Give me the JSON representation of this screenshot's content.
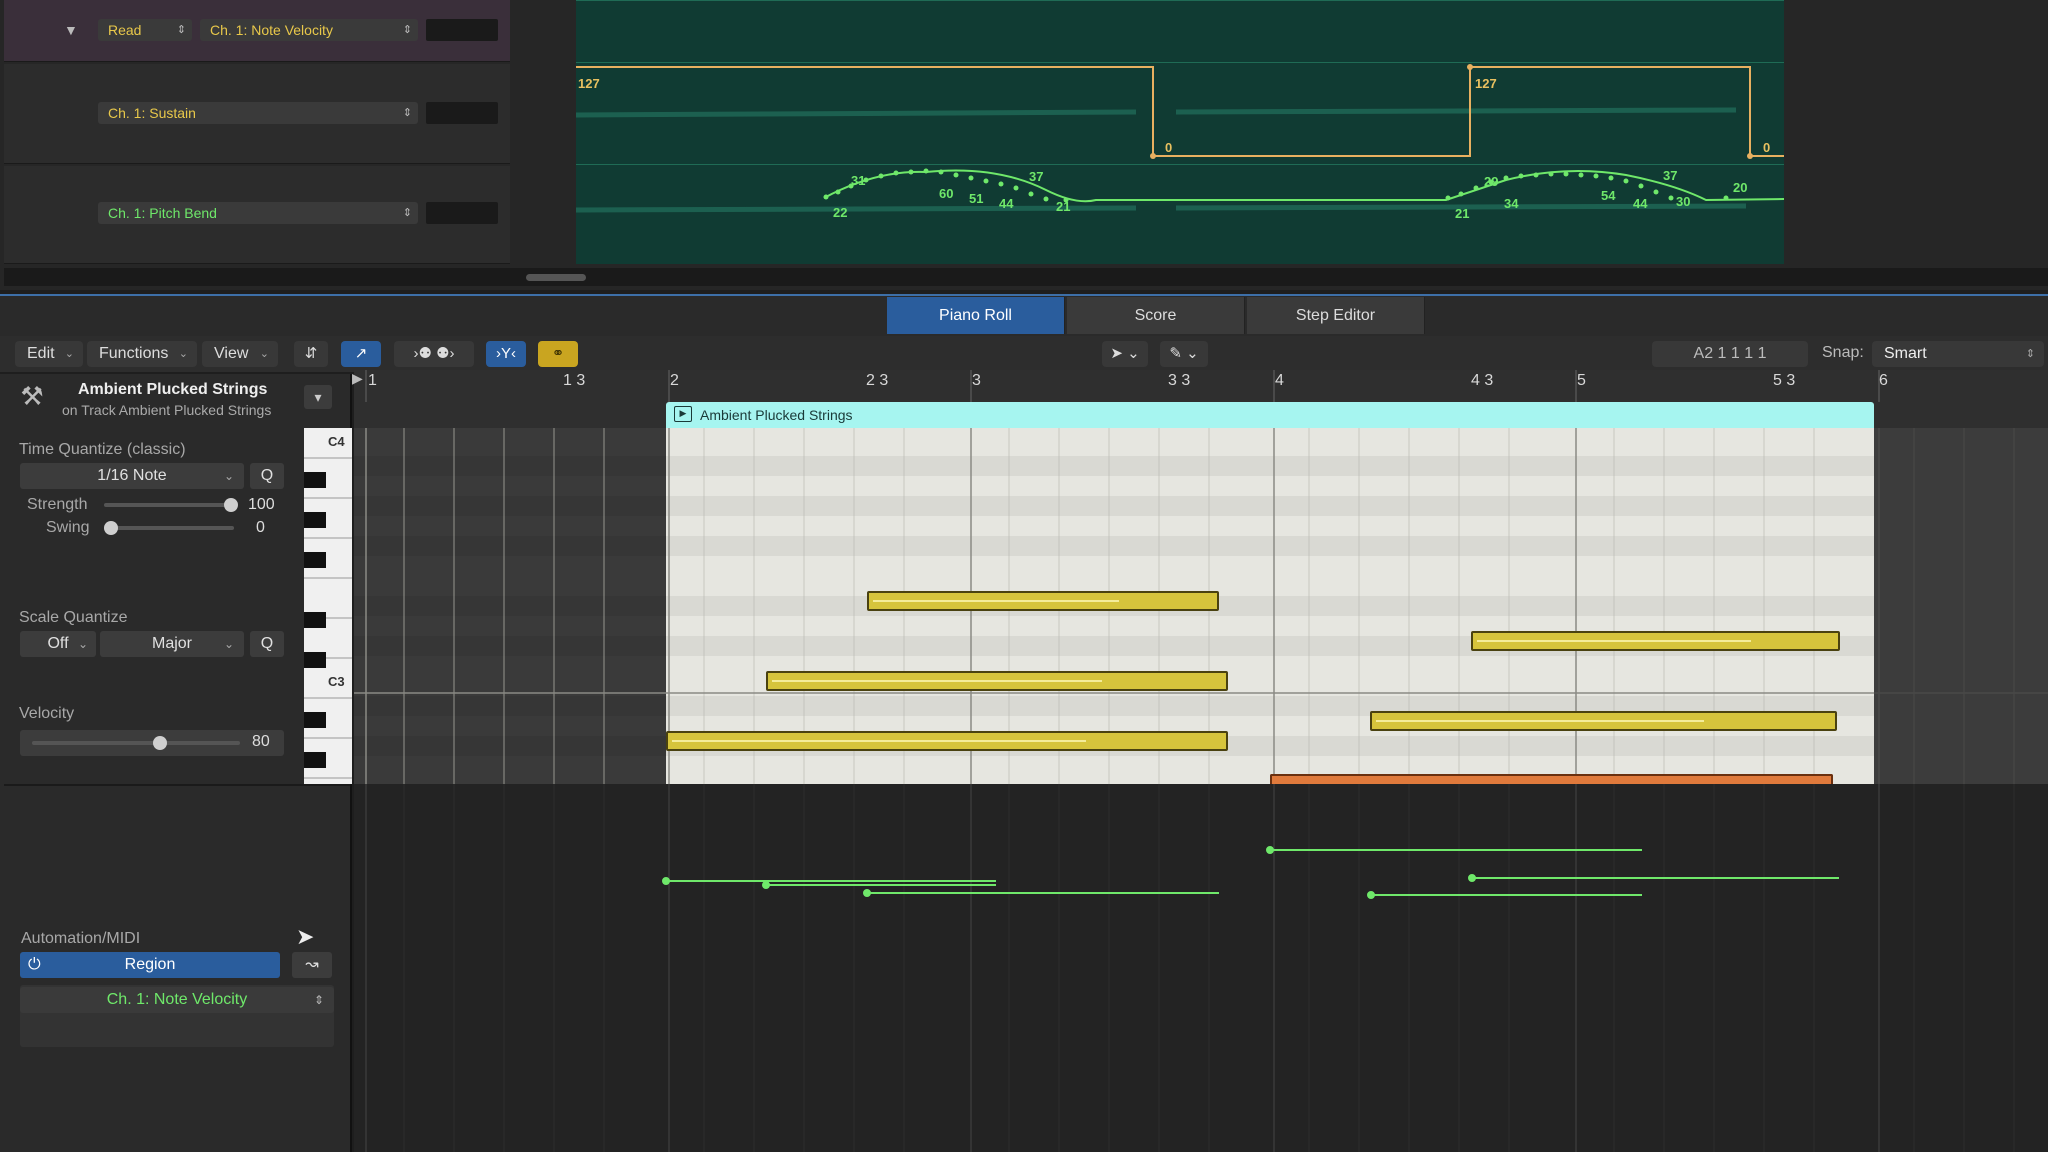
{
  "top_tracks": {
    "read_mode": "Read",
    "lanes": [
      {
        "param": "Ch. 1: Note Velocity"
      },
      {
        "param": "Ch. 1: Sustain"
      },
      {
        "param": "Ch. 1: Pitch Bend"
      }
    ],
    "sustain_values": [
      "127",
      "0",
      "127",
      "0"
    ],
    "pitch_bend_values": [
      "31",
      "22",
      "60",
      "51",
      "44",
      "37",
      "21",
      "29",
      "21",
      "34",
      "54",
      "44",
      "37",
      "30",
      "20"
    ]
  },
  "tabs": [
    "Piano Roll",
    "Score",
    "Step Editor"
  ],
  "toolbar": {
    "edit": "Edit",
    "functions": "Functions",
    "view": "View",
    "position": "A2  1 1 1 1",
    "snap_label": "Snap:",
    "snap_value": "Smart"
  },
  "inspector": {
    "region_name": "Ambient Plucked Strings",
    "track_name": "on Track Ambient Plucked Strings",
    "time_quantize_label": "Time Quantize (classic)",
    "time_quantize_value": "1/16 Note",
    "q_label": "Q",
    "strength_label": "Strength",
    "strength_value": "100",
    "swing_label": "Swing",
    "swing_value": "0",
    "scale_quantize_label": "Scale Quantize",
    "scale_off": "Off",
    "scale_major": "Major",
    "velocity_label": "Velocity",
    "velocity_value": "80",
    "automation_label": "Automation/MIDI",
    "region_button": "Region",
    "automation_param": "Ch. 1: Note Velocity"
  },
  "ruler": {
    "bars": [
      "1",
      "1 3",
      "2",
      "2 3",
      "3",
      "3 3",
      "4",
      "4 3",
      "5",
      "5 3",
      "6"
    ]
  },
  "region": {
    "title": "Ambient Plucked Strings"
  },
  "keyboard": {
    "c4": "C4",
    "c3": "C3"
  },
  "colors": {
    "accent_blue": "#2a5d9d",
    "note_yellow": "#d6c43c",
    "region_cyan": "#a6f5f0",
    "automation_green": "#6fe86a",
    "sustain_orange": "#e8b060"
  }
}
